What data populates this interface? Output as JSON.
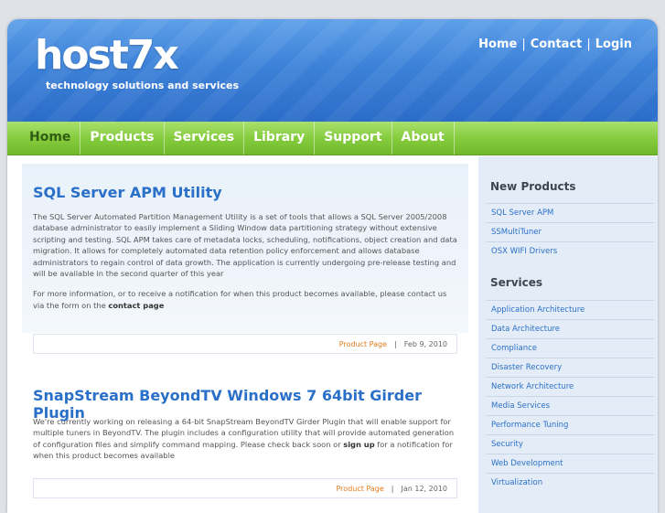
{
  "header": {
    "logo": "host7x",
    "tagline": "technology solutions and services",
    "links": [
      "Home",
      "Contact",
      "Login"
    ]
  },
  "nav": {
    "items": [
      "Home",
      "Products",
      "Services",
      "Library",
      "Support",
      "About"
    ]
  },
  "posts": [
    {
      "title": "SQL Server APM Utility",
      "body": "The SQL Server Automated Partition Management Utility is a set of tools that allows a SQL Server 2005/2008 database administrator to easily implement a Sliding Window data partitioning strategy without extensive scripting and testing. SQL APM takes care of metadata locks, scheduling, notifications, object creation and data migration. It allows for completely automated data retention policy enforcement and allows database administrators to regain control of data growth. The application is currently undergoing pre-release testing and will be available in the second quarter of this year",
      "body2_pre": "For more information, or to receive a notification for when this product becomes available, please contact us via the form on the ",
      "body2_link": "contact page",
      "product_link": "Product Page",
      "sep": "|",
      "date": "Feb 9, 2010"
    },
    {
      "title": "SnapStream BeyondTV Windows 7 64bit Girder Plugin",
      "body_pre": "We're currently working on releasing a 64-bit SnapStream BeyondTV Girder Plugin that will enable support for multiple tuners in BeyondTV. The plugin includes a configuration utility that will provide automated generation of configuration files and simplify command mapping. Please check back soon or ",
      "body_link": "sign up",
      "body_post": " for a notification for when this product becomes available",
      "product_link": "Product Page",
      "sep": "|",
      "date": "Jan 12, 2010"
    }
  ],
  "sidebar": {
    "new_products_heading": "New Products",
    "new_products": [
      "SQL Server APM",
      "SSMultiTuner",
      "OSX WIFI Drivers"
    ],
    "services_heading": "Services",
    "services": [
      "Application Architecture",
      "Data Architecture",
      "Compliance",
      "Disaster Recovery",
      "Network Architecture",
      "Media Services",
      "Performance Tuning",
      "Security",
      "Web Development",
      "Virtualization"
    ]
  }
}
